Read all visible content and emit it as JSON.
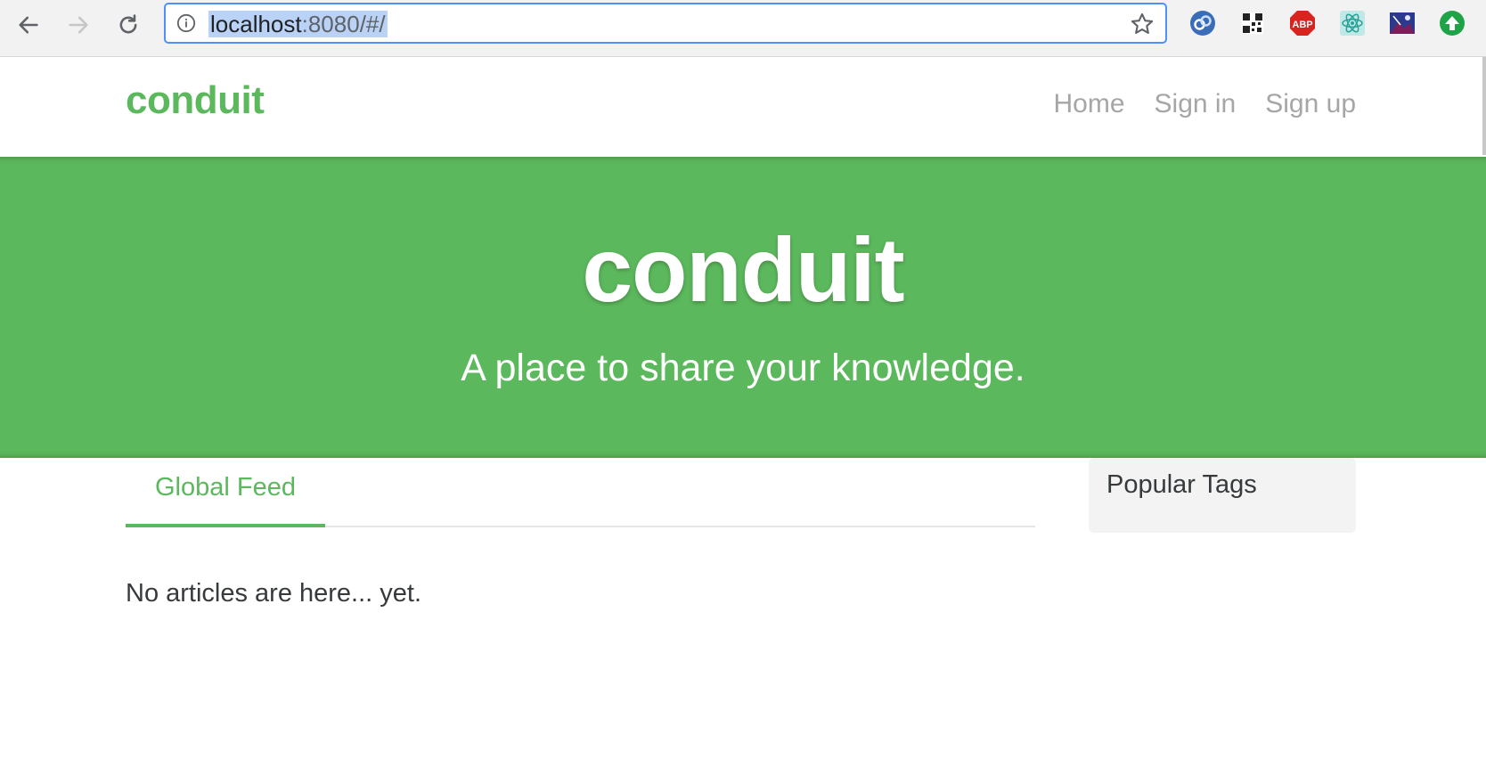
{
  "browser": {
    "url_host": "localhost",
    "url_rest": ":8080/#/",
    "extensions": [
      "chain-link-extension-icon",
      "qr-code-extension-icon",
      "adblock-plus-icon",
      "react-devtools-icon",
      "image-extension-icon",
      "upload-arrow-icon"
    ],
    "adblock_label": "ABP"
  },
  "nav": {
    "brand": "conduit",
    "links": [
      "Home",
      "Sign in",
      "Sign up"
    ]
  },
  "hero": {
    "title": "conduit",
    "subtitle": "A place to share your knowledge."
  },
  "feed": {
    "tab_label": "Global Feed",
    "empty_message": "No articles are here... yet."
  },
  "sidebar": {
    "title": "Popular Tags"
  },
  "colors": {
    "accent": "#5cb85c",
    "nav_link": "#a6a6a6",
    "sidebar_bg": "#f3f3f3"
  }
}
